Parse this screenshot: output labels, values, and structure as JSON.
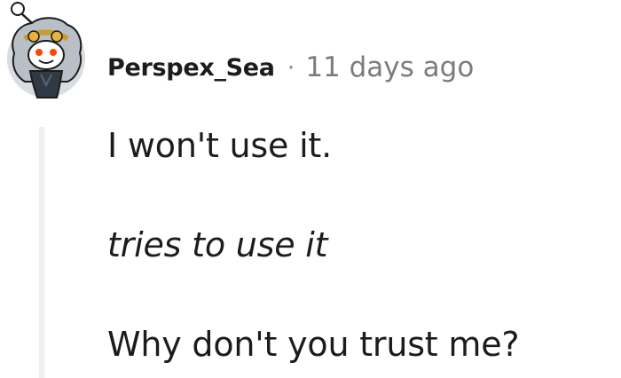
{
  "comment": {
    "username": "Perspex_Sea",
    "separator": "·",
    "timestamp": "11 days ago",
    "body": {
      "line1": "I won't use it.",
      "line2": "tries to use it",
      "line3": "Why don't you trust me?"
    }
  },
  "icons": {
    "avatar": "reddit-snoo-avatar-icon"
  },
  "colors": {
    "username": "#1c1c1c",
    "meta": "#7c7c7c",
    "thread_line": "#edeff1",
    "avatar_bg": "#d9dce0",
    "accent_orange": "#ff4500"
  }
}
